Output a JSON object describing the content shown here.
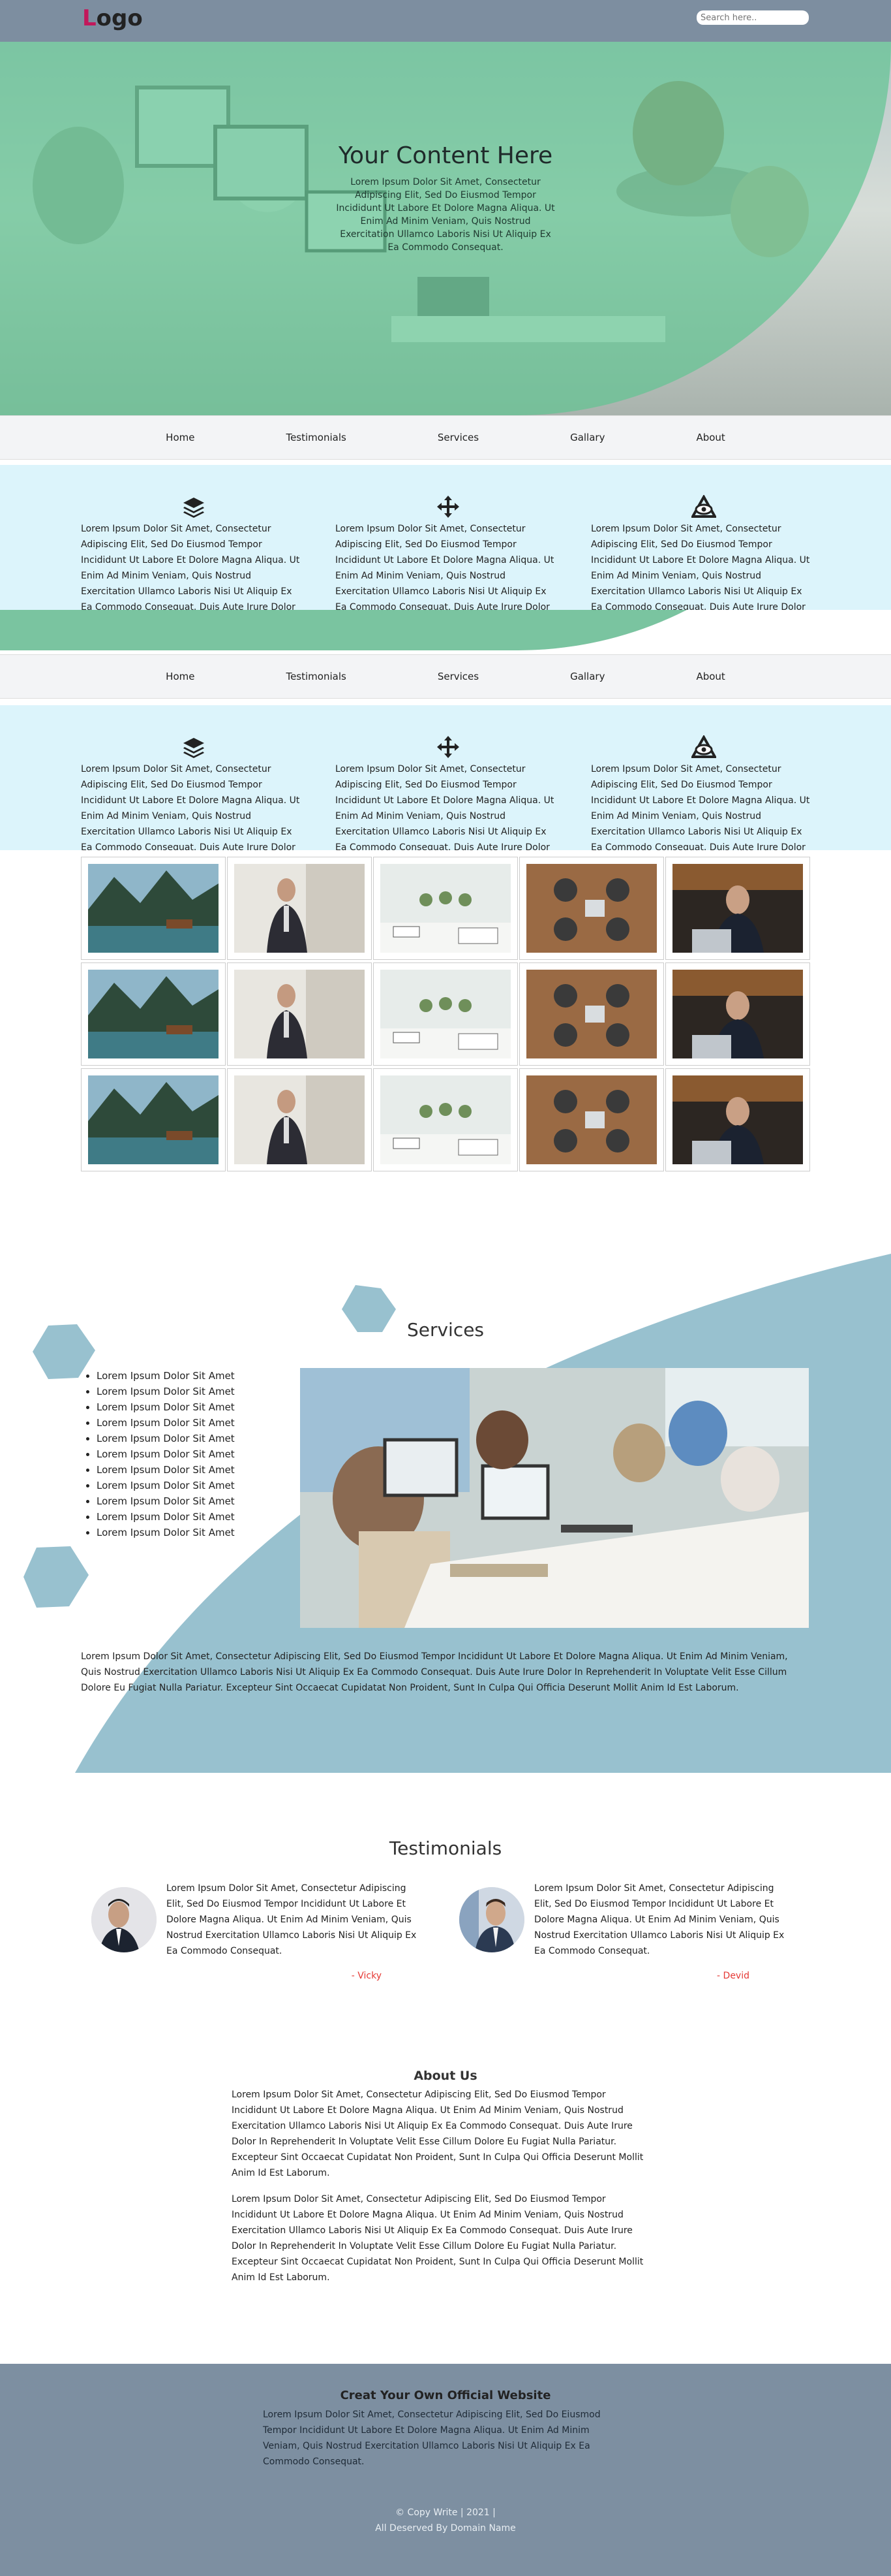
{
  "header": {
    "logo_first": "L",
    "logo_rest": "ogo",
    "search_placeholder": "Search here.."
  },
  "hero": {
    "title": "Your Content Here",
    "text": "Lorem Ipsum Dolor Sit Amet, Consectetur Adipiscing Elit, Sed Do Eiusmod Tempor Incididunt Ut Labore Et Dolore Magna Aliqua. Ut Enim Ad Minim Veniam, Quis Nostrud Exercitation Ullamco Laboris Nisi Ut Aliquip Ex Ea Commodo Consequat."
  },
  "nav": {
    "items": [
      "Home",
      "Testimonials",
      "Services",
      "Gallary",
      "About"
    ]
  },
  "features": {
    "icons": [
      "layers-icon",
      "move-arrows-icon",
      "eye-triangle-icon"
    ],
    "text": "Lorem Ipsum Dolor Sit Amet, Consectetur Adipiscing Elit, Sed Do Eiusmod Tempor Incididunt Ut Labore Et Dolore Magna Aliqua. Ut Enim Ad Minim Veniam, Quis Nostrud Exercitation Ullamco Laboris Nisi Ut Aliquip Ex Ea Commodo Consequat. Duis Aute Irure Dolor"
  },
  "services": {
    "title": "Services",
    "items": [
      "Lorem Ipsum Dolor Sit Amet",
      "Lorem Ipsum Dolor Sit Amet",
      "Lorem Ipsum Dolor Sit Amet",
      "Lorem Ipsum Dolor Sit Amet",
      "Lorem Ipsum Dolor Sit Amet",
      "Lorem Ipsum Dolor Sit Amet",
      "Lorem Ipsum Dolor Sit Amet",
      "Lorem Ipsum Dolor Sit Amet",
      "Lorem Ipsum Dolor Sit Amet",
      "Lorem Ipsum Dolor Sit Amet",
      "Lorem Ipsum Dolor Sit Amet"
    ],
    "paragraph": "Lorem Ipsum Dolor Sit Amet, Consectetur Adipiscing Elit, Sed Do Eiusmod Tempor Incididunt Ut Labore Et Dolore Magna Aliqua. Ut Enim Ad Minim Veniam, Quis Nostrud Exercitation Ullamco Laboris Nisi Ut Aliquip Ex Ea Commodo Consequat. Duis Aute Irure Dolor In Reprehenderit In Voluptate Velit Esse Cillum Dolore Eu Fugiat Nulla Pariatur. Excepteur Sint Occaecat Cupidatat Non Proident, Sunt In Culpa Qui Officia Deserunt Mollit Anim Id Est Laborum."
  },
  "testimonials": {
    "title": "Testimonials",
    "cards": [
      {
        "text": "Lorem Ipsum Dolor Sit Amet, Consectetur Adipiscing Elit, Sed Do Eiusmod Tempor Incididunt Ut Labore Et Dolore Magna Aliqua. Ut Enim Ad Minim Veniam, Quis Nostrud Exercitation Ullamco Laboris Nisi Ut Aliquip Ex Ea Commodo Consequat.",
        "name": "- Vicky"
      },
      {
        "text": "Lorem Ipsum Dolor Sit Amet, Consectetur Adipiscing Elit, Sed Do Eiusmod Tempor Incididunt Ut Labore Et Dolore Magna Aliqua. Ut Enim Ad Minim Veniam, Quis Nostrud Exercitation Ullamco Laboris Nisi Ut Aliquip Ex Ea Commodo Consequat.",
        "name": "- Devid"
      }
    ]
  },
  "about": {
    "title": "About Us",
    "p1": "Lorem Ipsum Dolor Sit Amet, Consectetur Adipiscing Elit, Sed Do Eiusmod Tempor Incididunt Ut Labore Et Dolore Magna Aliqua. Ut Enim Ad Minim Veniam, Quis Nostrud Exercitation Ullamco Laboris Nisi Ut Aliquip Ex Ea Commodo Consequat. Duis Aute Irure Dolor In Reprehenderit In Voluptate Velit Esse Cillum Dolore Eu Fugiat Nulla Pariatur. Excepteur Sint Occaecat Cupidatat Non Proident, Sunt In Culpa Qui Officia Deserunt Mollit Anim Id Est Laborum.",
    "p2": "Lorem Ipsum Dolor Sit Amet, Consectetur Adipiscing Elit, Sed Do Eiusmod Tempor Incididunt Ut Labore Et Dolore Magna Aliqua. Ut Enim Ad Minim Veniam, Quis Nostrud Exercitation Ullamco Laboris Nisi Ut Aliquip Ex Ea Commodo Consequat. Duis Aute Irure Dolor In Reprehenderit In Voluptate Velit Esse Cillum Dolore Eu Fugiat Nulla Pariatur. Excepteur Sint Occaecat Cupidatat Non Proident, Sunt In Culpa Qui Officia Deserunt Mollit Anim Id Est Laborum."
  },
  "footer": {
    "title": "Creat Your Own Official Website",
    "text": "Lorem Ipsum Dolor Sit Amet, Consectetur Adipiscing Elit, Sed Do Eiusmod Tempor Incididunt Ut Labore Et Dolore Magna Aliqua. Ut Enim Ad Minim Veniam, Quis Nostrud Exercitation Ullamco Laboris Nisi Ut Aliquip Ex Ea Commodo Consequat.",
    "copy1": "© Copy Write | 2021 |",
    "copy2": "All Deserved By Domain Name"
  },
  "colors": {
    "header_bg": "#7d8ea0",
    "hero_overlay": "#5fc491",
    "feature_bg": "#dcf4fb",
    "services_shape": "#98c1cf",
    "logo_accent": "#c2185b",
    "testimonial_name": "#e53935"
  }
}
